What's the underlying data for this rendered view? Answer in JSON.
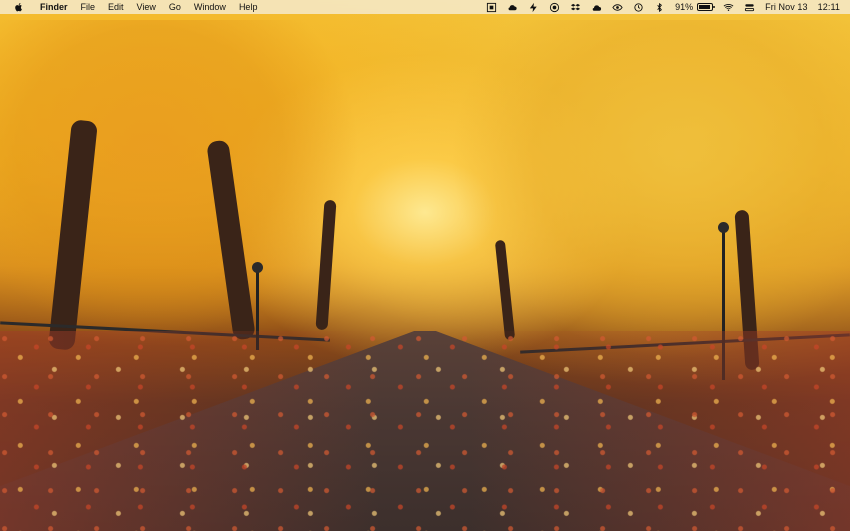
{
  "menubar": {
    "app_menu": "Finder",
    "menus": [
      "File",
      "Edit",
      "View",
      "Go",
      "Window",
      "Help"
    ],
    "tray_icons": [
      {
        "name": "screen-capture-icon"
      },
      {
        "name": "cloud-sync-icon"
      },
      {
        "name": "bolt-icon"
      },
      {
        "name": "record-icon"
      },
      {
        "name": "dropbox-icon"
      },
      {
        "name": "cloud-icon"
      },
      {
        "name": "eye-icon"
      },
      {
        "name": "time-machine-icon"
      },
      {
        "name": "bluetooth-icon"
      }
    ],
    "battery": {
      "percent_text": "91%",
      "level": 0.91
    },
    "wifi_icon": "wifi-icon",
    "control_icon": "control-center-icon",
    "date": "Fri Nov 13",
    "time": "12:11"
  }
}
